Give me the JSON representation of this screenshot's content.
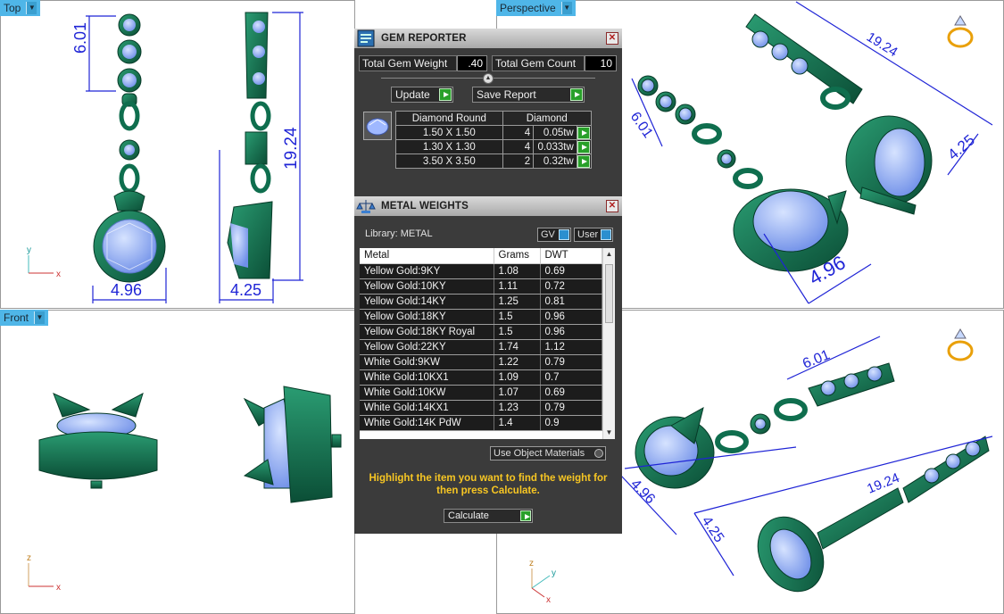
{
  "viewports": {
    "top": {
      "label": "Top",
      "dims": {
        "height_top": "6.01",
        "length": "19.24",
        "width_front": "4.96",
        "width_side": "4.25"
      },
      "axes": {
        "up": "y",
        "right": "x"
      }
    },
    "perspective": {
      "label": "Perspective",
      "dims": {
        "height_top": "6.01",
        "length": "19.24",
        "width_a": "4.96",
        "width_b": "4.25"
      }
    },
    "front": {
      "label": "Front",
      "axes": {
        "up": "z",
        "right": "x"
      }
    },
    "bottom_right": {
      "dims": {
        "height_top": "6.01",
        "length": "19.24",
        "width_a": "4.96",
        "width_b": "4.25"
      },
      "axes": {
        "up": "z",
        "right": "y",
        "diag": "x"
      }
    }
  },
  "gem_reporter": {
    "title": "GEM REPORTER",
    "total_weight_label": "Total Gem Weight",
    "total_weight_value": ".40",
    "total_count_label": "Total Gem Count",
    "total_count_value": "10",
    "update_label": "Update",
    "save_report_label": "Save Report",
    "table_headers": [
      "Diamond Round",
      "Diamond"
    ],
    "rows": [
      {
        "size": "1.50 X 1.50",
        "count": "4",
        "weight": "0.05tw"
      },
      {
        "size": "1.30 X 1.30",
        "count": "4",
        "weight": "0.033tw"
      },
      {
        "size": "3.50 X 3.50",
        "count": "2",
        "weight": "0.32tw"
      }
    ]
  },
  "metal_weights": {
    "title": "METAL WEIGHTS",
    "library_label": "Library: METAL",
    "gv_label": "GV",
    "user_label": "User",
    "headers": [
      "Metal",
      "Grams",
      "DWT"
    ],
    "rows": [
      {
        "metal": "Yellow Gold:9KY",
        "grams": "1.08",
        "dwt": "0.69"
      },
      {
        "metal": "Yellow Gold:10KY",
        "grams": "1.11",
        "dwt": "0.72"
      },
      {
        "metal": "Yellow Gold:14KY",
        "grams": "1.25",
        "dwt": "0.81"
      },
      {
        "metal": "Yellow Gold:18KY",
        "grams": "1.5",
        "dwt": "0.96"
      },
      {
        "metal": "Yellow Gold:18KY Royal",
        "grams": "1.5",
        "dwt": "0.96"
      },
      {
        "metal": "Yellow Gold:22KY",
        "grams": "1.74",
        "dwt": "1.12"
      },
      {
        "metal": "White Gold:9KW",
        "grams": "1.22",
        "dwt": "0.79"
      },
      {
        "metal": "White Gold:10KX1",
        "grams": "1.09",
        "dwt": "0.7"
      },
      {
        "metal": "White Gold:10KW",
        "grams": "1.07",
        "dwt": "0.69"
      },
      {
        "metal": "White Gold:14KX1",
        "grams": "1.23",
        "dwt": "0.79"
      },
      {
        "metal": "White Gold:14K PdW",
        "grams": "1.4",
        "dwt": "0.9"
      }
    ],
    "use_object_materials_label": "Use Object Materials",
    "hint": "Highlight the item you want to find the weight for then press Calculate.",
    "calculate_label": "Calculate"
  },
  "colors": {
    "tab": "#4fb6e8",
    "dimension": "#1f24d6",
    "metal": "#0f6e4e",
    "gem": "#8fb2ff",
    "panel": "#3b3b3b",
    "hint": "#f7c623",
    "go_button": "#29a02a"
  }
}
